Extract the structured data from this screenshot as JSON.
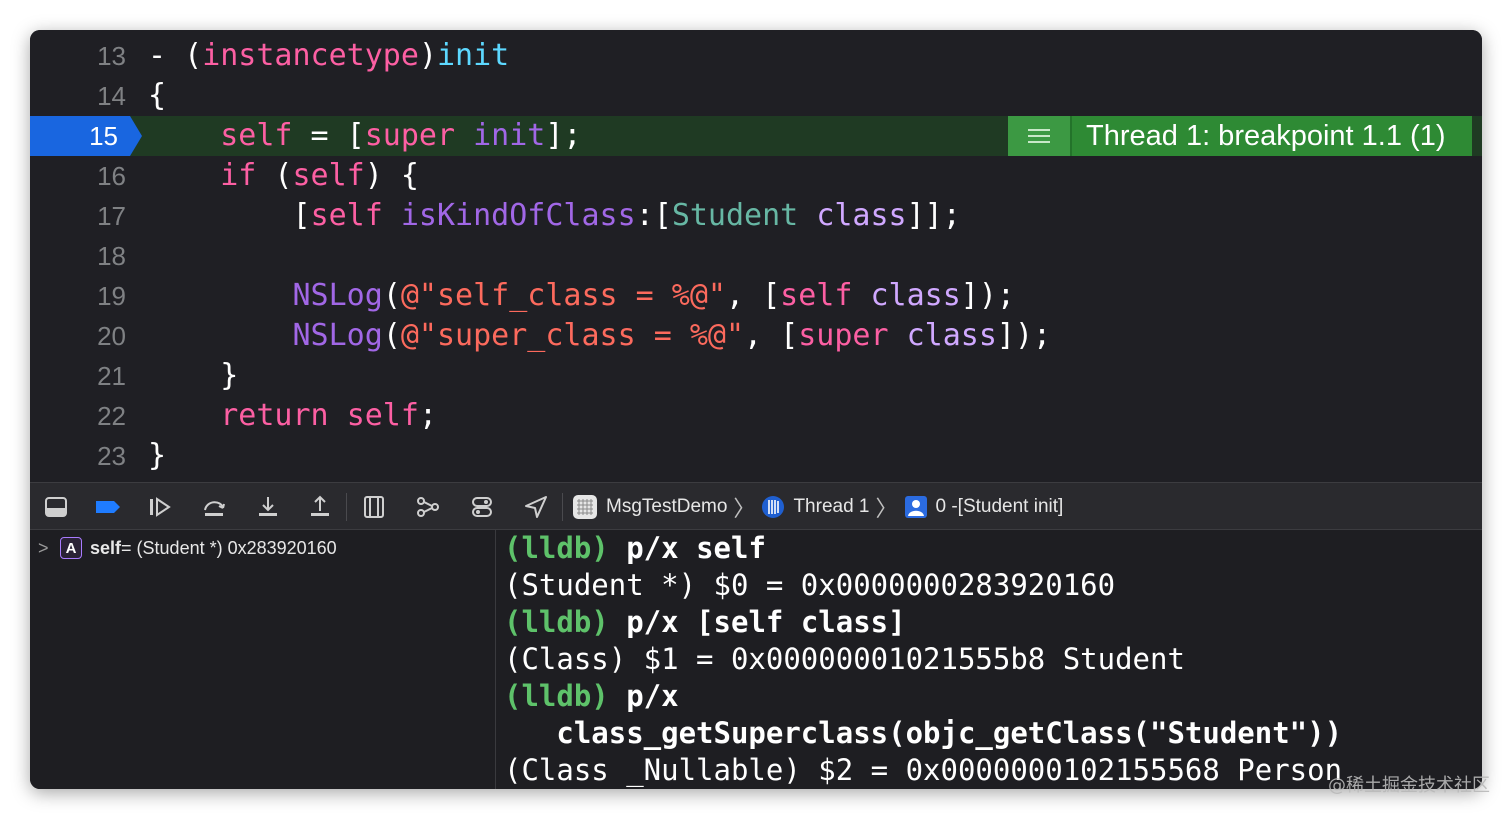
{
  "editor": {
    "lines": [
      {
        "num": "13",
        "code": [
          {
            "t": "- (",
            "c": "pl"
          },
          {
            "t": "instancetype",
            "c": "kw"
          },
          {
            "t": ")",
            "c": "pl"
          },
          {
            "t": "init",
            "c": "ty"
          }
        ]
      },
      {
        "num": "14",
        "code": [
          {
            "t": "{",
            "c": "pl"
          }
        ]
      },
      {
        "num": "15",
        "code": [
          {
            "t": "    ",
            "c": "pl"
          },
          {
            "t": "self",
            "c": "kw"
          },
          {
            "t": " = [",
            "c": "pl"
          },
          {
            "t": "super",
            "c": "kw"
          },
          {
            "t": " ",
            "c": "pl"
          },
          {
            "t": "init",
            "c": "fn"
          },
          {
            "t": "];",
            "c": "pl"
          }
        ]
      },
      {
        "num": "16",
        "code": [
          {
            "t": "    ",
            "c": "pl"
          },
          {
            "t": "if",
            "c": "kw"
          },
          {
            "t": " (",
            "c": "pl"
          },
          {
            "t": "self",
            "c": "kw"
          },
          {
            "t": ") {",
            "c": "pl"
          }
        ]
      },
      {
        "num": "17",
        "code": [
          {
            "t": "        [",
            "c": "pl"
          },
          {
            "t": "self",
            "c": "kw"
          },
          {
            "t": " ",
            "c": "pl"
          },
          {
            "t": "isKindOfClass",
            "c": "fn"
          },
          {
            "t": ":[",
            "c": "pl"
          },
          {
            "t": "Student",
            "c": "tyb"
          },
          {
            "t": " ",
            "c": "pl"
          },
          {
            "t": "class",
            "c": "cls"
          },
          {
            "t": "]];",
            "c": "pl"
          }
        ]
      },
      {
        "num": "18",
        "code": []
      },
      {
        "num": "19",
        "code": [
          {
            "t": "        ",
            "c": "pl"
          },
          {
            "t": "NSLog",
            "c": "fn"
          },
          {
            "t": "(",
            "c": "pl"
          },
          {
            "t": "@\"self_class = %@\"",
            "c": "str"
          },
          {
            "t": ", [",
            "c": "pl"
          },
          {
            "t": "self",
            "c": "kw"
          },
          {
            "t": " ",
            "c": "pl"
          },
          {
            "t": "class",
            "c": "cls"
          },
          {
            "t": "]);",
            "c": "pl"
          }
        ]
      },
      {
        "num": "20",
        "code": [
          {
            "t": "        ",
            "c": "pl"
          },
          {
            "t": "NSLog",
            "c": "fn"
          },
          {
            "t": "(",
            "c": "pl"
          },
          {
            "t": "@\"super_class = %@\"",
            "c": "str"
          },
          {
            "t": ", [",
            "c": "pl"
          },
          {
            "t": "super",
            "c": "kw"
          },
          {
            "t": " ",
            "c": "pl"
          },
          {
            "t": "class",
            "c": "cls"
          },
          {
            "t": "]);",
            "c": "pl"
          }
        ]
      },
      {
        "num": "21",
        "code": [
          {
            "t": "    }",
            "c": "pl"
          }
        ]
      },
      {
        "num": "22",
        "code": [
          {
            "t": "    ",
            "c": "pl"
          },
          {
            "t": "return",
            "c": "kw"
          },
          {
            "t": " ",
            "c": "pl"
          },
          {
            "t": "self",
            "c": "kw"
          },
          {
            "t": ";",
            "c": "pl"
          }
        ]
      },
      {
        "num": "23",
        "code": [
          {
            "t": "}",
            "c": "pl"
          }
        ]
      }
    ],
    "breakpoint_line": "15",
    "thread_badge": "Thread 1: breakpoint 1.1 (1)"
  },
  "debug_bar": {
    "icons": [
      "hide-debug-area-icon",
      "breakpoints-toggle-icon",
      "continue-icon",
      "step-over-icon",
      "step-into-icon",
      "step-out-icon",
      "view-hierarchy-icon",
      "memory-graph-icon",
      "environment-overrides-icon",
      "simulate-location-icon"
    ],
    "crumbs": {
      "app": "MsgTestDemo",
      "thread": "Thread 1",
      "frame": "0 -[Student init]"
    }
  },
  "variables": {
    "badge": "A",
    "name": "self",
    "value": " = (Student *) 0x283920160"
  },
  "console": {
    "lines": [
      {
        "prompt": "(lldb)",
        "text": " p/x self"
      },
      {
        "prompt": "",
        "text": "(Student *) $0 = 0x0000000283920160"
      },
      {
        "prompt": "(lldb)",
        "text": " p/x [self class]"
      },
      {
        "prompt": "",
        "text": "(Class) $1 = 0x00000001021555b8 Student"
      },
      {
        "prompt": "(lldb)",
        "text": " p/x"
      },
      {
        "prompt": "",
        "text": "   class_getSuperclass(objc_getClass(\"Student\"))",
        "bold": true
      },
      {
        "prompt": "",
        "text": "(Class _Nullable) $2 = 0x0000000102155568 Person"
      }
    ]
  },
  "watermark": "@稀土掘金技术社区",
  "colors": {
    "background": "#1f1f24",
    "keyword": "#fc5fa3",
    "function": "#a167e6",
    "type": "#5dd8ff",
    "string": "#fc6a5d",
    "breakpoint": "#1966e0",
    "thread_badge": "#2e8a34",
    "lldb_prompt": "#5ec26a"
  }
}
